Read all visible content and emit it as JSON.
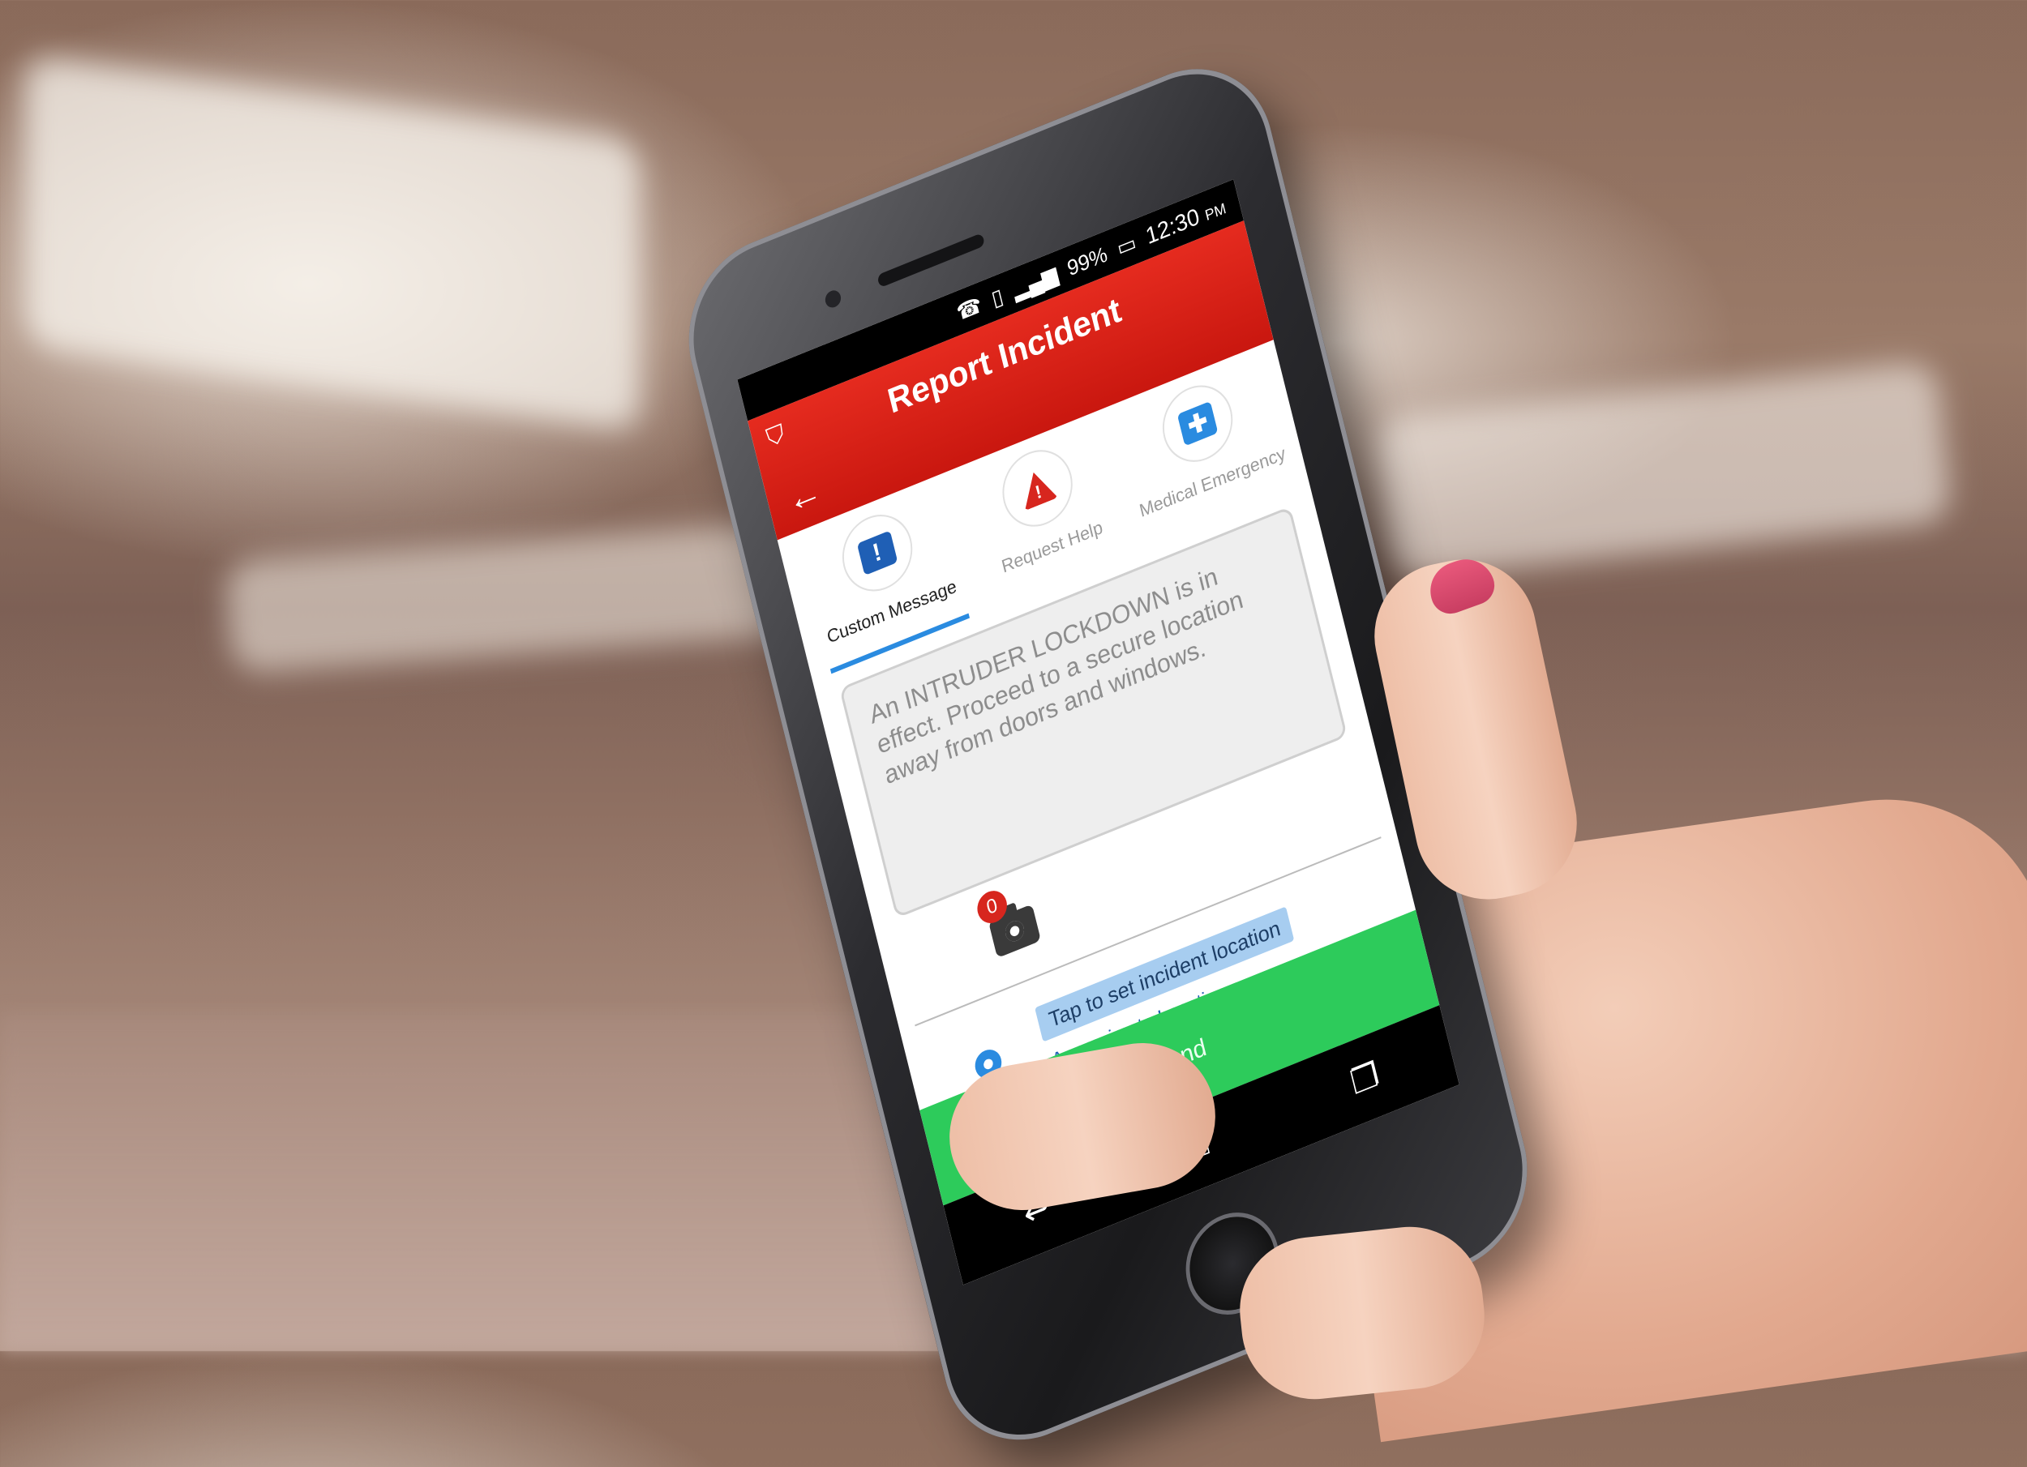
{
  "status_bar": {
    "battery": "99%",
    "time": "12:30",
    "ampm": "PM"
  },
  "app_bar": {
    "title": "Report Incident"
  },
  "tabs": [
    {
      "label": "Custom Message",
      "icon": "message-icon",
      "active": true
    },
    {
      "label": "Request Help",
      "icon": "warning-icon",
      "active": false
    },
    {
      "label": "Medical Emergency",
      "icon": "medical-cross-icon",
      "active": false
    }
  ],
  "message": {
    "text": "An INTRUDER LOCKDOWN is in effect. Proceed to a secure location away from doors and windows."
  },
  "photos": {
    "count": "0"
  },
  "location": {
    "tap_label": "Tap to set incident location",
    "approx_label": "Approximate Location:",
    "address": "11720 Beltsville Drive Beltsville, MD 20705"
  },
  "send": {
    "label": "Send"
  },
  "colors": {
    "app_bar_red": "#d8231a",
    "send_green": "#2dcb5b",
    "accent_blue": "#2a8be0"
  }
}
